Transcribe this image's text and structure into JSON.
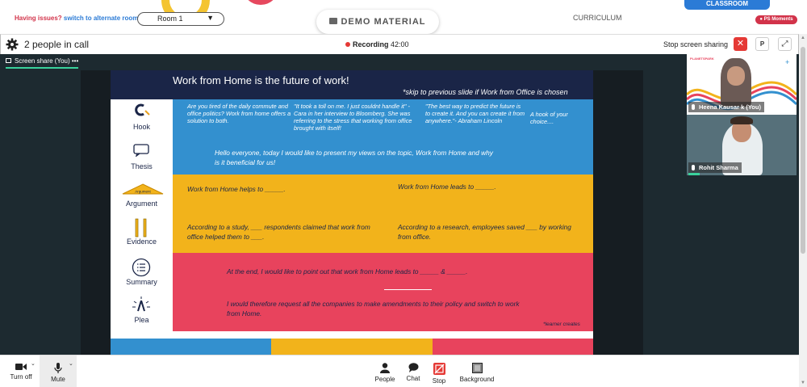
{
  "topbar": {
    "issues_question": "Having issues?",
    "issues_link": "switch to alternate room",
    "room_label": "Room 1",
    "demo_label": "DEMO MATERIAL",
    "curriculum_label": "CURRICULUM",
    "classroom_label": "CLASSROOM",
    "moments_label": "PS Moments"
  },
  "callbar": {
    "people_count": "2 people in call",
    "recording_label": "Recording",
    "recording_time": "42:00",
    "stop_share_label": "Stop screen sharing",
    "p_button": "P",
    "close_glyph": "✕",
    "expand_glyph": "⤢"
  },
  "stage": {
    "tab_label": "Screen share (You)",
    "tab_more": "•••"
  },
  "slide": {
    "title": "Work from Home is the future of work!",
    "note": "*skip to previous slide if Work from Office is chosen",
    "labels": {
      "hook": "Hook",
      "thesis": "Thesis",
      "argument": "Argument",
      "argument_badge": "Argument",
      "evidence": "Evidence",
      "summary": "Summary",
      "plea": "Plea"
    },
    "hook_col1": "Are you tired of the daily commute and office politics? Work from home offers a solution to both.",
    "hook_col2": "\"It took a toll on me. I just couldnt handle it\" - Cara in her interview to Bloomberg. She was referring to the stress that working from office brought with itself!",
    "hook_col3": "\"The best way to predict the future is to create it. And you can create it from anywhere.\"- Abraham Lincoln",
    "hook_col4": "A hook of your choice....",
    "thesis_text": "Hello everyone, today I would like to present my views on the topic, Work from Home and why is it beneficial for us!",
    "argument_left": "Work from Home helps to _____.",
    "argument_right": "Work from Home leads to _____.",
    "evidence_left": "According to a study, ___ respondents claimed that work from office helped them to ___.",
    "evidence_right": "According to a research, employees saved ___ by working from office.",
    "summary_text": "At the end, I would like to point out that work from Home leads to _____ & _____.",
    "plea_text": "I would therefore request all the companies to make amendments to their policy and switch to work from Home.",
    "credit": "*learner creates"
  },
  "participants": [
    {
      "name": "Heena Kausar k (You)",
      "logo": "PLANETSPARK"
    },
    {
      "name": "Rohit Sharma"
    }
  ],
  "toolbar": {
    "turn_off": "Turn off",
    "mute": "Mute",
    "people": "People",
    "chat": "Chat",
    "stop": "Stop",
    "background": "Background"
  },
  "colors": {
    "slide_navy": "#1a2547",
    "slide_blue": "#3390cf",
    "slide_yellow": "#f2b31b",
    "slide_red": "#e8435d",
    "recording_red": "#e53935",
    "accent_green": "#3ad19c"
  }
}
